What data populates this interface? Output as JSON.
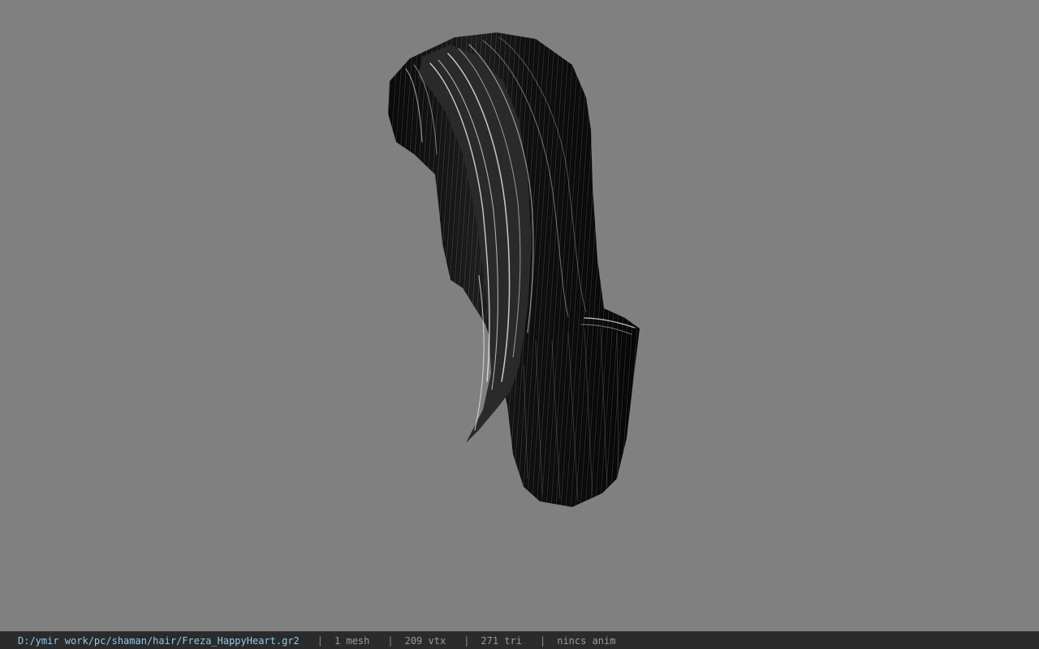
{
  "viewer": {
    "background_color": "#808080",
    "model_icon": "hair-mesh-3d-model"
  },
  "statusbar": {
    "file_path": "D:/ymir work/pc/shaman/hair/Freza_HappyHeart.gr2",
    "separator": "|",
    "mesh_count": "1 mesh",
    "vertex_count": "209 vtx",
    "triangle_count": "271 tri",
    "anim_info": "nincs anim",
    "path_color": "#8fc8e8",
    "text_color": "#9a9a9a"
  }
}
